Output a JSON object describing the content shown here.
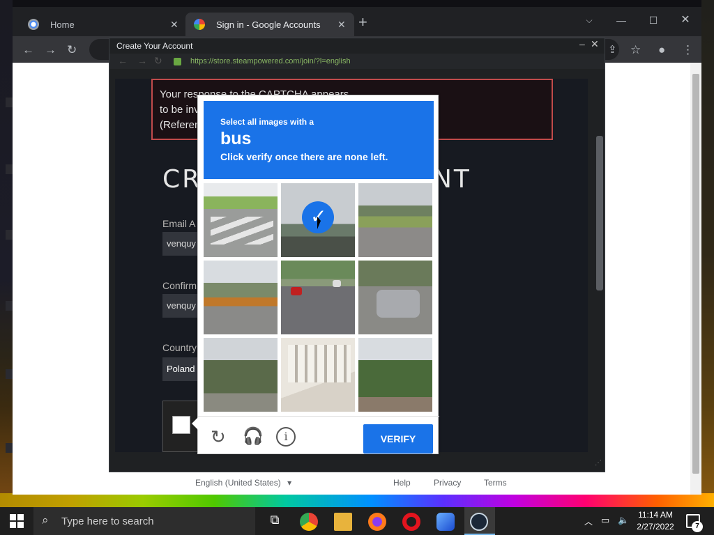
{
  "browser": {
    "tabs": [
      {
        "label": "Home"
      },
      {
        "label": "Sign in - Google Accounts"
      }
    ],
    "new_tab_symbol": "+"
  },
  "popup": {
    "title": "Create Your Account",
    "url": "https://store.steampowered.com/join/?l=english"
  },
  "steam": {
    "error_text": "Your response to the CAPTCHA appears to be invalid. Please re-verify that you're n",
    "error_line3": "(Referen",
    "heading_left": "CRE",
    "heading_right": "NT",
    "email_label": "Email A",
    "email_value": "venquy",
    "confirm_label": "Confirm",
    "confirm_value": "venquy",
    "country_label": "Country",
    "country_value": "Poland"
  },
  "captcha": {
    "select_text": "Select all images with a",
    "object": "bus",
    "instruction": "Click verify once there are none left.",
    "verify_label": "VERIFY",
    "selected_tile": 2
  },
  "page_footer": {
    "language": "English (United States)",
    "links": [
      "Help",
      "Privacy",
      "Terms"
    ]
  },
  "taskbar": {
    "search_placeholder": "Type here to search",
    "time": "11:14 AM",
    "date": "2/27/2022",
    "notification_count": "7"
  },
  "colors": {
    "captcha_blue": "#1a73e8",
    "error_border": "#c14b4b"
  }
}
